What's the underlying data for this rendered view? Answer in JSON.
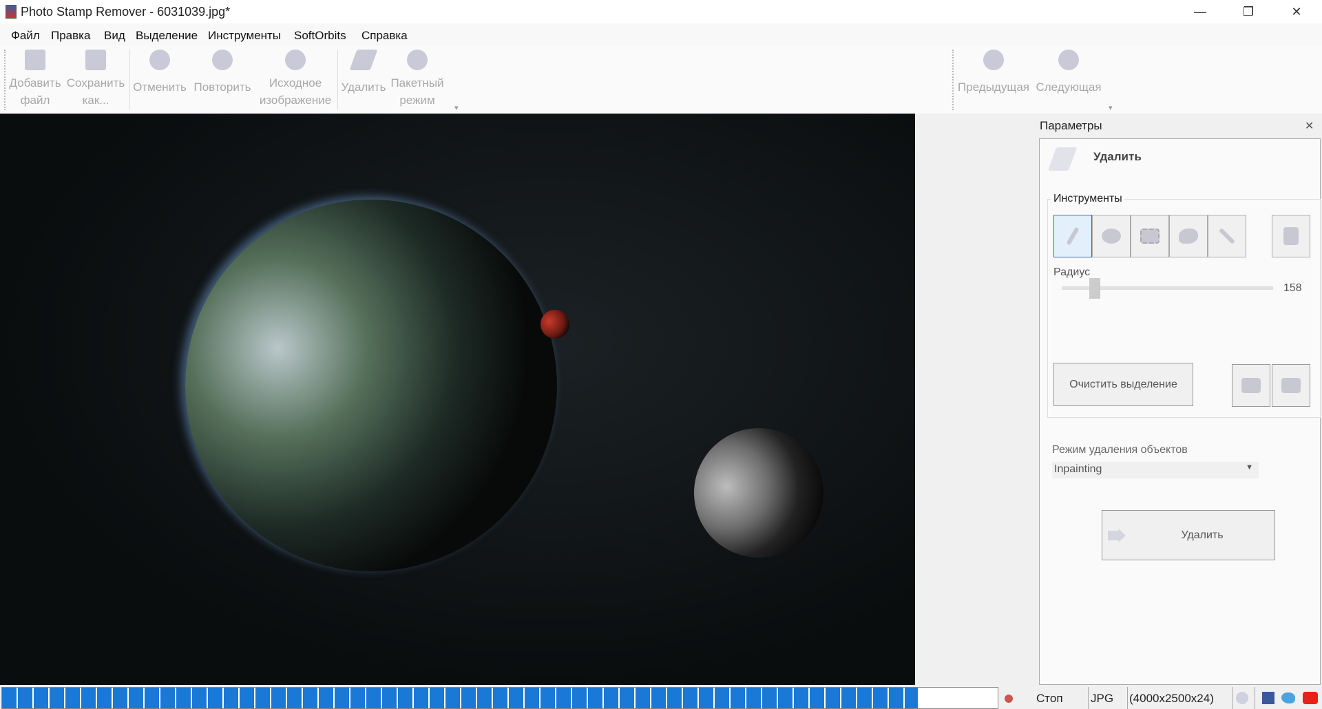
{
  "window": {
    "title": "Photo Stamp Remover - 6031039.jpg*",
    "minimize": "—",
    "maximize": "❐",
    "close": "✕"
  },
  "menu": [
    "Файл",
    "Правка",
    "Вид",
    "Выделение",
    "Инструменты",
    "SoftOrbits",
    "Справка"
  ],
  "toolbar": {
    "add_file": [
      "Добавить",
      "файл"
    ],
    "save_as": [
      "Сохранить",
      "как..."
    ],
    "undo": "Отменить",
    "redo": "Повторить",
    "original": [
      "Исходное",
      "изображение"
    ],
    "remove": "Удалить",
    "batch": [
      "Пакетный",
      "режим"
    ],
    "previous": "Предыдущая",
    "next": "Следующая",
    "overflow": "▾"
  },
  "panel": {
    "title": "Параметры",
    "close": "✕",
    "header": "Удалить",
    "tools_group": "Инструменты",
    "tools": [
      "pencil-icon",
      "ellipse-select-icon",
      "rect-select-icon",
      "lasso-icon",
      "magic-wand-icon"
    ],
    "stamp_tool": "stamp-icon",
    "radius_label": "Радиус",
    "radius_value": "158",
    "radius_min": 1,
    "radius_max": 1000,
    "clear_selection": "Очистить выделение",
    "mode_label": "Режим удаления объектов",
    "mode_value": "Inpainting",
    "remove_button": "Удалить"
  },
  "status": {
    "progress_percent": 92,
    "stop": "Стоп",
    "format": "JPG",
    "dimensions": "(4000x2500x24)"
  },
  "colors": {
    "progress": "#1a78d6",
    "selected_tool": "#e3effa"
  }
}
